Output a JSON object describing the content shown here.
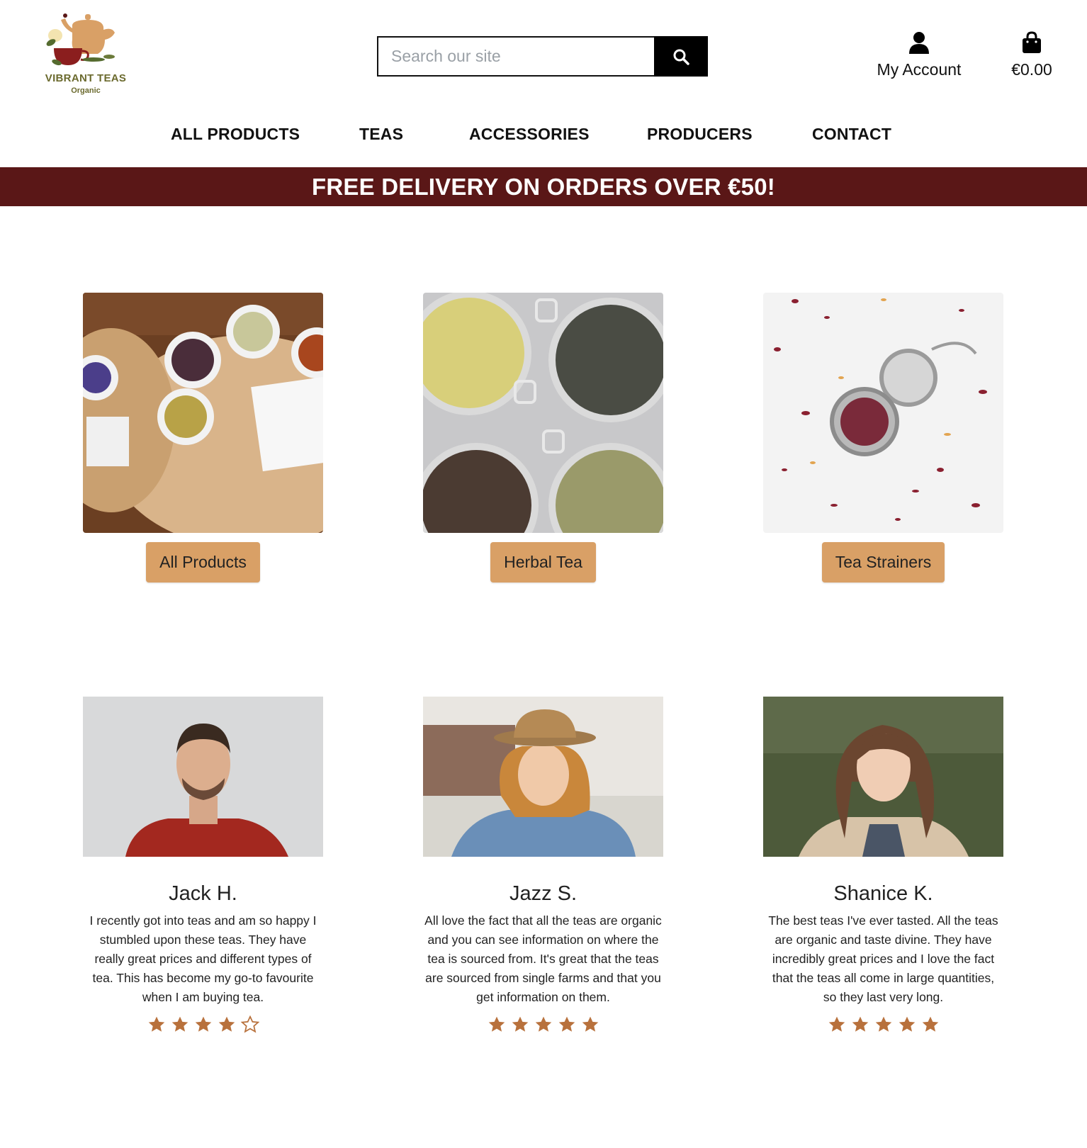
{
  "brand": {
    "name": "VIBRANT TEAS",
    "sub": "Organic"
  },
  "search": {
    "placeholder": "Search our site"
  },
  "account": {
    "label": "My Account"
  },
  "cart": {
    "total": "€0.00"
  },
  "nav": [
    "ALL PRODUCTS",
    "TEAS",
    "ACCESSORIES",
    "PRODUCERS",
    "CONTACT"
  ],
  "banner": {
    "text": "FREE DELIVERY ON ORDERS OVER €50!"
  },
  "categories": [
    {
      "button": "All Products"
    },
    {
      "button": "Herbal Tea"
    },
    {
      "button": "Tea Strainers"
    }
  ],
  "testimonials": [
    {
      "name": "Jack H.",
      "text": "I recently got into teas and am so happy I stumbled upon these teas. They have really great prices and different types of tea. This has become my go-to favourite when I am buying tea.",
      "rating": 4
    },
    {
      "name": "Jazz S.",
      "text": "All love the fact that all the teas are organic and you can see information on where the tea is sourced from. It's great that the teas are sourced from single farms and that you get information on them.",
      "rating": 5
    },
    {
      "name": "Shanice K.",
      "text": "The best teas I've ever tasted. All the teas are organic and taste divine. They have incredibly great prices and I love the fact that the teas all come in large quantities, so they last very long.",
      "rating": 5
    }
  ],
  "colors": {
    "banner": "#5a1717",
    "button": "#d9a066",
    "star": "#b8713c"
  },
  "icons": [
    "search-icon",
    "user-icon",
    "shopping-bag-icon",
    "star-icon"
  ]
}
